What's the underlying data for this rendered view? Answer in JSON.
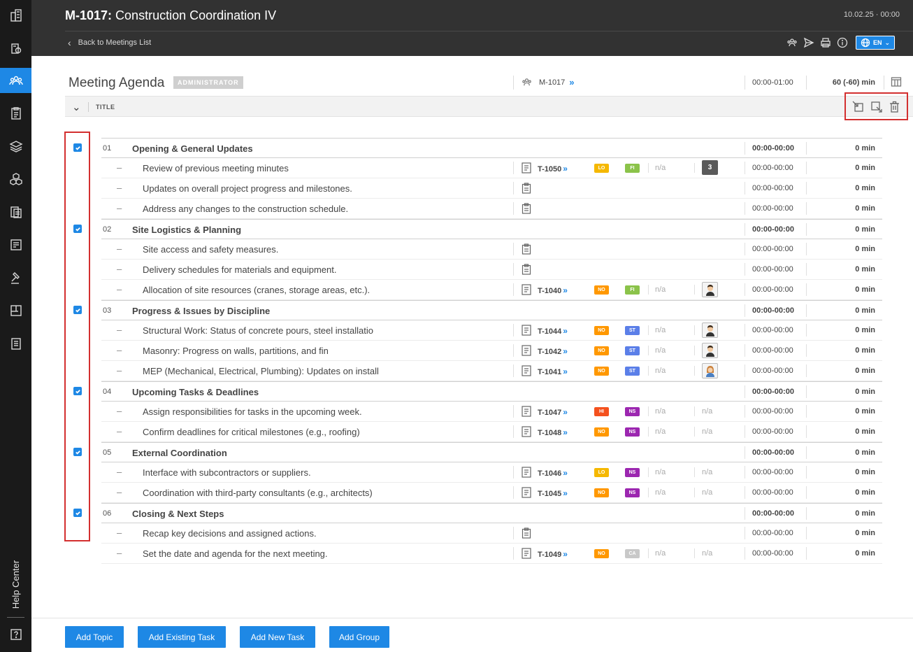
{
  "header": {
    "meeting_id": "M-1017:",
    "meeting_name": "Construction Coordination IV",
    "datetime": "10.02.25 · 00:00",
    "back_label": "Back to Meetings List",
    "language": "EN"
  },
  "agenda": {
    "title": "Meeting Agenda",
    "role_badge": "ADMINISTRATOR",
    "meeting_ref": "M-1017",
    "time_range": "00:00-01:00",
    "duration": "60 (-60) min",
    "column_title": "TITLE"
  },
  "rows": [
    {
      "type": "topic",
      "num": "01",
      "title": "Opening & General Updates",
      "time": "00:00-00:00",
      "mins": "0 min",
      "checked": true
    },
    {
      "type": "item",
      "title": "Review of previous meeting minutes",
      "task": "T-1050",
      "p1": "LO",
      "p1c": "#f5b800",
      "p2": "FI",
      "p2c": "#8bc34a",
      "na1": "n/a",
      "count": "3",
      "time": "00:00-00:00",
      "mins": "0 min"
    },
    {
      "type": "item",
      "title": "Updates on overall project progress and milestones.",
      "time": "00:00-00:00",
      "mins": "0 min"
    },
    {
      "type": "item",
      "title": "Address any changes to the construction schedule.",
      "time": "00:00-00:00",
      "mins": "0 min"
    },
    {
      "type": "topic",
      "num": "02",
      "title": "Site Logistics & Planning",
      "time": "00:00-00:00",
      "mins": "0 min",
      "checked": true
    },
    {
      "type": "item",
      "title": "Site access and safety measures.",
      "time": "00:00-00:00",
      "mins": "0 min"
    },
    {
      "type": "item",
      "title": "Delivery schedules for materials and equipment.",
      "time": "00:00-00:00",
      "mins": "0 min"
    },
    {
      "type": "item",
      "title": "Allocation of site resources (cranes, storage areas, etc.).",
      "task": "T-1040",
      "p1": "NO",
      "p1c": "#ff9800",
      "p2": "FI",
      "p2c": "#8bc34a",
      "na1": "n/a",
      "avatar": "man",
      "time": "00:00-00:00",
      "mins": "0 min"
    },
    {
      "type": "topic",
      "num": "03",
      "title": "Progress & Issues by Discipline",
      "time": "00:00-00:00",
      "mins": "0 min",
      "checked": true
    },
    {
      "type": "item",
      "title": "Structural Work: Status of concrete pours, steel installatio",
      "task": "T-1044",
      "p1": "NO",
      "p1c": "#ff9800",
      "p2": "ST",
      "p2c": "#5b7fe8",
      "na1": "n/a",
      "avatar": "man",
      "time": "00:00-00:00",
      "mins": "0 min"
    },
    {
      "type": "item",
      "title": "Masonry: Progress on walls, partitions, and fin",
      "task": "T-1042",
      "p1": "NO",
      "p1c": "#ff9800",
      "p2": "ST",
      "p2c": "#5b7fe8",
      "na1": "n/a",
      "avatar": "man",
      "time": "00:00-00:00",
      "mins": "0 min"
    },
    {
      "type": "item",
      "title": "MEP (Mechanical, Electrical, Plumbing): Updates on install",
      "task": "T-1041",
      "p1": "NO",
      "p1c": "#ff9800",
      "p2": "ST",
      "p2c": "#5b7fe8",
      "na1": "n/a",
      "avatar": "woman",
      "time": "00:00-00:00",
      "mins": "0 min"
    },
    {
      "type": "topic",
      "num": "04",
      "title": "Upcoming Tasks & Deadlines",
      "time": "00:00-00:00",
      "mins": "0 min",
      "checked": true
    },
    {
      "type": "item",
      "title": "Assign responsibilities for tasks in the upcoming week.",
      "task": "T-1047",
      "p1": "HI",
      "p1c": "#f4511e",
      "p2": "NS",
      "p2c": "#9c27b0",
      "na1": "n/a",
      "na2": "n/a",
      "time": "00:00-00:00",
      "mins": "0 min"
    },
    {
      "type": "item",
      "title": "Confirm deadlines for critical milestones (e.g., roofing)",
      "task": "T-1048",
      "p1": "NO",
      "p1c": "#ff9800",
      "p2": "NS",
      "p2c": "#9c27b0",
      "na1": "n/a",
      "na2": "n/a",
      "time": "00:00-00:00",
      "mins": "0 min"
    },
    {
      "type": "topic",
      "num": "05",
      "title": "External Coordination",
      "time": "00:00-00:00",
      "mins": "0 min",
      "checked": true
    },
    {
      "type": "item",
      "title": "Interface with subcontractors or suppliers.",
      "task": "T-1046",
      "p1": "LO",
      "p1c": "#f5b800",
      "p2": "NS",
      "p2c": "#9c27b0",
      "na1": "n/a",
      "na2": "n/a",
      "time": "00:00-00:00",
      "mins": "0 min"
    },
    {
      "type": "item",
      "title": "Coordination with third-party consultants (e.g., architects)",
      "task": "T-1045",
      "p1": "NO",
      "p1c": "#ff9800",
      "p2": "NS",
      "p2c": "#9c27b0",
      "na1": "n/a",
      "na2": "n/a",
      "time": "00:00-00:00",
      "mins": "0 min"
    },
    {
      "type": "topic",
      "num": "06",
      "title": "Closing & Next Steps",
      "time": "00:00-00:00",
      "mins": "0 min",
      "checked": true
    },
    {
      "type": "item",
      "title": "Recap key decisions and assigned actions.",
      "time": "00:00-00:00",
      "mins": "0 min"
    },
    {
      "type": "item",
      "title": "Set the date and agenda for the next meeting.",
      "task": "T-1049",
      "p1": "NO",
      "p1c": "#ff9800",
      "p2": "CA",
      "p2c": "#c8c8c8",
      "na1": "n/a",
      "na2": "n/a",
      "time": "00:00-00:00",
      "mins": "0 min"
    }
  ],
  "footer": {
    "add_topic": "Add Topic",
    "add_existing_task": "Add Existing Task",
    "add_new_task": "Add New Task",
    "add_group": "Add Group"
  },
  "sidebar": {
    "help_center": "Help Center"
  },
  "colors": {
    "accent": "#1e88e5",
    "highlight": "#d32f2f",
    "header_bg": "#323232",
    "rail_bg": "#1a1a1a"
  }
}
